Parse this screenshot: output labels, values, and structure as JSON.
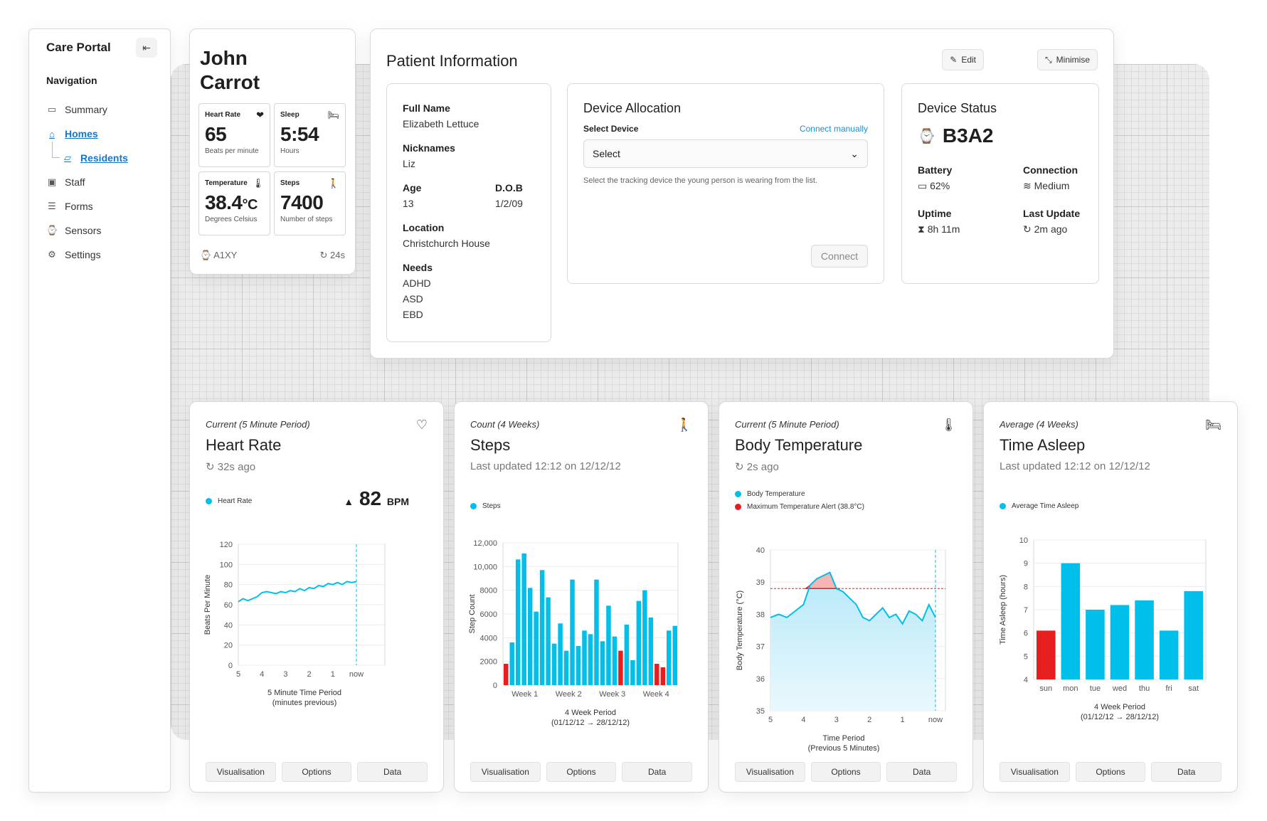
{
  "sidebar": {
    "title": "Care Portal",
    "nav_heading": "Navigation",
    "items": [
      {
        "label": "Summary",
        "icon": "window-icon"
      },
      {
        "label": "Homes",
        "icon": "home-icon"
      },
      {
        "label": "Residents",
        "icon": "folder-icon"
      },
      {
        "label": "Staff",
        "icon": "badge-icon"
      },
      {
        "label": "Forms",
        "icon": "form-icon"
      },
      {
        "label": "Sensors",
        "icon": "watch-icon"
      },
      {
        "label": "Settings",
        "icon": "gear-icon"
      }
    ]
  },
  "patient_card": {
    "first_name": "John",
    "last_name": "Carrot",
    "heart_rate": {
      "label": "Heart Rate",
      "value": "65",
      "sub": "Beats per minute"
    },
    "sleep": {
      "label": "Sleep",
      "value": "5:54",
      "sub": "Hours"
    },
    "temperature": {
      "label": "Temperature",
      "value": "38.4",
      "unit": "°C",
      "sub": "Degrees Celsius"
    },
    "steps": {
      "label": "Steps",
      "value": "7400",
      "sub": "Number of steps"
    },
    "device_id": "A1XY",
    "refresh": "24s"
  },
  "patient_info": {
    "title": "Patient Information",
    "edit_label": "Edit",
    "minimise_label": "Minimise",
    "fields": {
      "full_name_label": "Full Name",
      "full_name": "Elizabeth Lettuce",
      "nicknames_label": "Nicknames",
      "nicknames": "Liz",
      "age_label": "Age",
      "age": "13",
      "dob_label": "D.O.B",
      "dob": "1/2/09",
      "location_label": "Location",
      "location": "Christchurch House",
      "needs_label": "Needs",
      "needs": [
        "ADHD",
        "ASD",
        "EBD"
      ]
    },
    "device_allocation": {
      "title": "Device Allocation",
      "select_label": "Select Device",
      "connect_manually": "Connect manually",
      "select_value": "Select",
      "help": "Select the tracking device the young person is wearing from the list.",
      "connect_label": "Connect"
    },
    "device_status": {
      "title": "Device Status",
      "device_id": "B3A2",
      "battery_label": "Battery",
      "battery": "62%",
      "connection_label": "Connection",
      "connection": "Medium",
      "uptime_label": "Uptime",
      "uptime": "8h 11m",
      "last_update_label": "Last Update",
      "last_update": "2m ago"
    }
  },
  "tabs": [
    "Visualisation",
    "Options",
    "Data"
  ],
  "colors": {
    "accent": "#00bfea",
    "alert": "#e61e1e",
    "link": "#1677c9"
  },
  "cards": {
    "heart": {
      "subtitle": "Current (5 Minute Period)",
      "title": "Heart Rate",
      "updated": "32s ago",
      "legend": "Heart Rate",
      "reading": "82",
      "reading_unit": "BPM"
    },
    "steps": {
      "subtitle": "Count (4 Weeks)",
      "title": "Steps",
      "updated": "Last updated 12:12 on 12/12/12",
      "legend": "Steps"
    },
    "temp": {
      "subtitle": "Current (5 Minute Period)",
      "title": "Body Temperature",
      "updated": "2s ago",
      "legend": "Body Temperature",
      "legend2": "Maximum Temperature Alert (38.8°C)"
    },
    "sleep": {
      "subtitle": "Average (4 Weeks)",
      "title": "Time Asleep",
      "updated": "Last updated 12:12 on 12/12/12",
      "legend": "Average Time Asleep"
    }
  },
  "chart_data": [
    {
      "type": "line",
      "ylabel": "Beats Per Minute",
      "xlabel": "5 Minute Time Period",
      "xlabel2": "(minutes previous)",
      "xticks": [
        "5",
        "4",
        "3",
        "2",
        "1",
        "now"
      ],
      "yticks": [
        0,
        20,
        40,
        60,
        80,
        100,
        120
      ],
      "ylim": [
        0,
        120
      ],
      "x": [
        5.0,
        4.8,
        4.6,
        4.4,
        4.2,
        4.0,
        3.8,
        3.6,
        3.4,
        3.2,
        3.0,
        2.8,
        2.6,
        2.4,
        2.2,
        2.0,
        1.8,
        1.6,
        1.4,
        1.2,
        1.0,
        0.8,
        0.6,
        0.4,
        0.2,
        0.0
      ],
      "values": [
        63,
        66,
        64,
        66,
        68,
        72,
        73,
        72,
        71,
        73,
        72,
        74,
        73,
        76,
        74,
        77,
        76,
        79,
        78,
        81,
        80,
        82,
        80,
        83,
        82,
        83
      ]
    },
    {
      "type": "bar",
      "ylabel": "Step Count",
      "xlabel": "4 Week Period",
      "xlabel2": "(01/12/12 → 28/12/12)",
      "xticks": [
        "Week 1",
        "Week 2",
        "Week 3",
        "Week 4"
      ],
      "yticks": [
        0,
        2000,
        4000,
        6000,
        8000,
        10000,
        12000
      ],
      "ytick_labels": [
        "0",
        "2000",
        "4000",
        "6000",
        "8000",
        "10,000",
        "12,000"
      ],
      "ylim": [
        0,
        12000
      ],
      "values": [
        1800,
        3600,
        10600,
        11100,
        8200,
        6200,
        9700,
        7400,
        3500,
        5200,
        2900,
        8900,
        3300,
        4600,
        4300,
        8900,
        3700,
        6700,
        4100,
        2900,
        5100,
        2100,
        7100,
        8000,
        5700,
        1800,
        1500,
        4600,
        5000
      ],
      "alert": [
        true,
        false,
        false,
        false,
        false,
        false,
        false,
        false,
        false,
        false,
        false,
        false,
        false,
        false,
        false,
        false,
        false,
        false,
        false,
        true,
        false,
        false,
        false,
        false,
        false,
        true,
        true,
        false,
        false
      ]
    },
    {
      "type": "area",
      "ylabel": "Body Temperature (°C)",
      "xlabel": "Time Period",
      "xlabel2": "(Previous 5 Minutes)",
      "xticks": [
        "5",
        "4",
        "3",
        "2",
        "1",
        "now"
      ],
      "yticks": [
        35,
        36,
        37,
        38,
        39,
        40
      ],
      "ylim": [
        35,
        40
      ],
      "threshold": 38.8,
      "x": [
        5.0,
        4.75,
        4.5,
        4.25,
        4.0,
        3.8,
        3.6,
        3.4,
        3.2,
        3.0,
        2.8,
        2.6,
        2.4,
        2.2,
        2.0,
        1.8,
        1.6,
        1.4,
        1.2,
        1.0,
        0.8,
        0.6,
        0.4,
        0.2,
        0.0
      ],
      "values": [
        37.9,
        38.0,
        37.9,
        38.1,
        38.3,
        38.9,
        39.1,
        39.2,
        39.3,
        38.8,
        38.7,
        38.5,
        38.3,
        37.9,
        37.8,
        38.0,
        38.2,
        37.9,
        38.0,
        37.7,
        38.1,
        38.0,
        37.8,
        38.3,
        37.9
      ]
    },
    {
      "type": "bar",
      "ylabel": "Time Asleep (hours)",
      "xlabel": "4 Week Period",
      "xlabel2": "(01/12/12 → 28/12/12)",
      "categories": [
        "sun",
        "mon",
        "tue",
        "wed",
        "thu",
        "fri",
        "sat"
      ],
      "values": [
        6.1,
        9.0,
        7.0,
        7.2,
        7.4,
        6.1,
        7.8
      ],
      "alert": [
        true,
        false,
        false,
        false,
        false,
        false,
        false
      ],
      "yticks": [
        4,
        5,
        6,
        7,
        8,
        9,
        10
      ],
      "ylim": [
        4,
        10
      ]
    }
  ]
}
